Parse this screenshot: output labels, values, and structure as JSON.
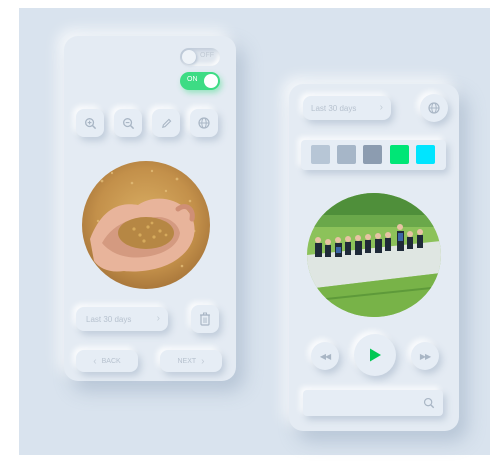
{
  "left_card": {
    "toggle_off_label": "OFF",
    "toggle_on_label": "ON",
    "icons": [
      "zoom-in-icon",
      "zoom-out-icon",
      "pencil-icon",
      "globe-icon"
    ],
    "period_dropdown": "Last 30 days",
    "back_label": "BACK",
    "next_label": "NEXT",
    "colors": {
      "toggle_on": "#3ddc84"
    }
  },
  "right_card": {
    "period_dropdown": "Last 30 days",
    "swatches": [
      "#b7c6d6",
      "#a6b6c8",
      "#8c9cb0",
      "#00e676",
      "#00e5ff"
    ],
    "colors": {
      "play": "#00c853"
    }
  }
}
